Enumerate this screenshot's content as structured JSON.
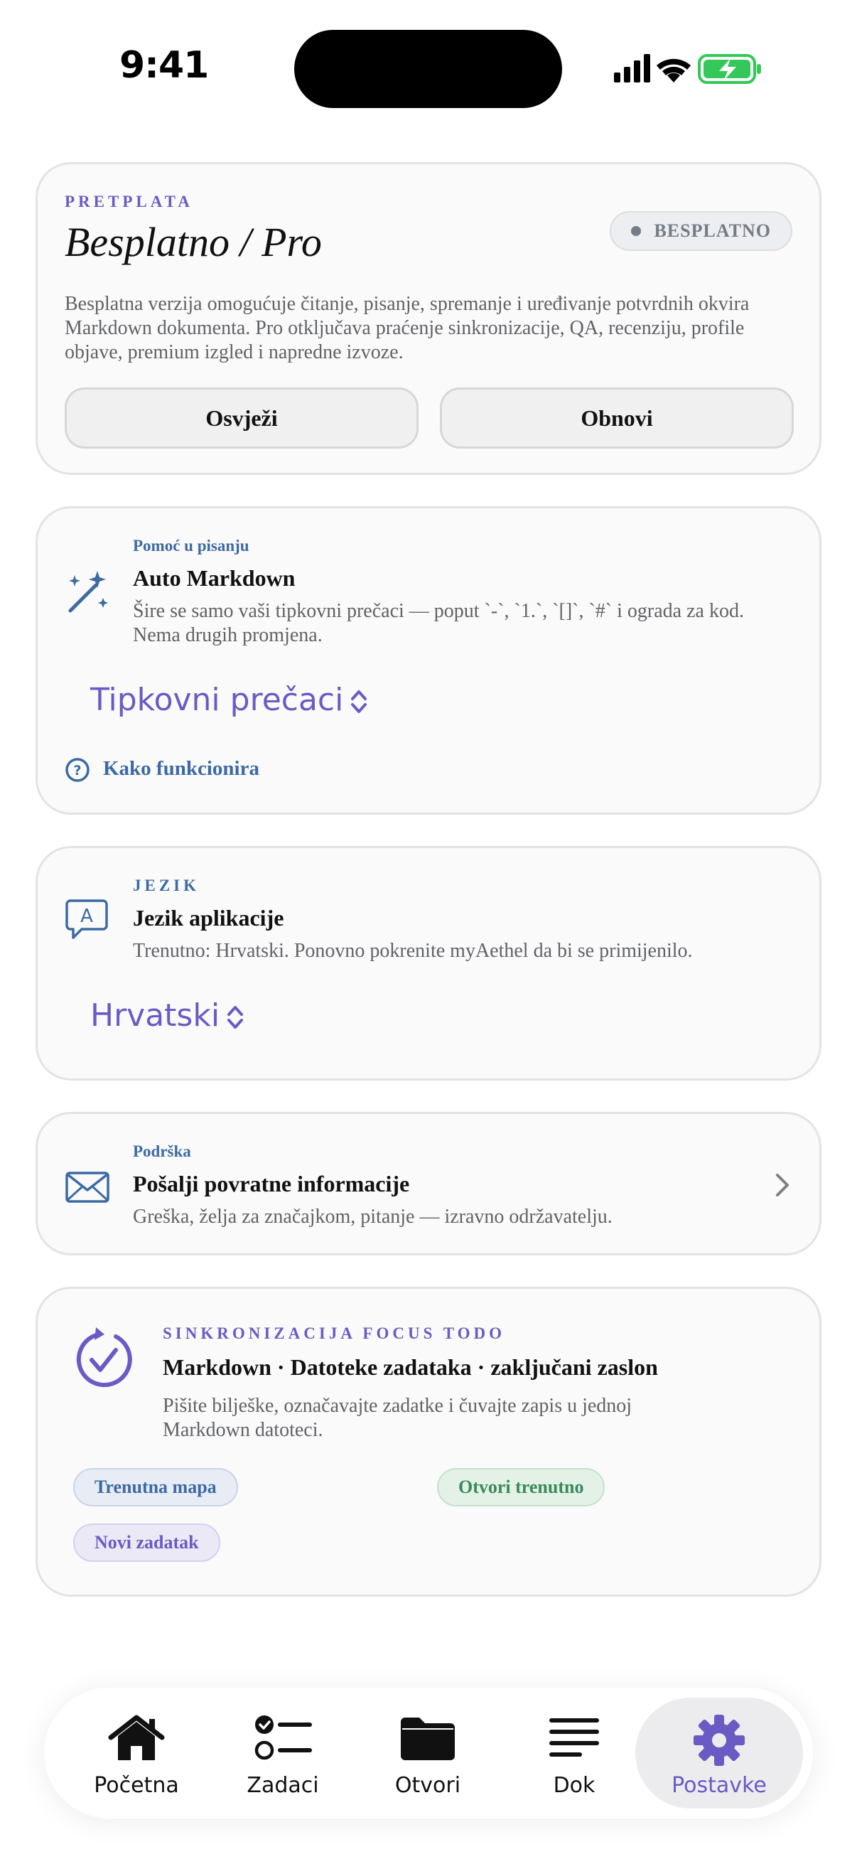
{
  "status_bar": {
    "time": "9:41",
    "icons": [
      "cellular-icon",
      "wifi-icon",
      "battery-charging-icon"
    ]
  },
  "colors": {
    "accent_purple": "#6a5bc4",
    "accent_blue": "#3d6aa3",
    "accent_green": "#3a8a5a",
    "battery_green": "#34c759"
  },
  "subscription": {
    "eyebrow": "PRETPLATA",
    "title": "Besplatno / Pro",
    "badge": "BESPLATNO",
    "description": "Besplatna verzija omogućuje čitanje, pisanje, spremanje i uređivanje potvrdnih okvira Markdown dokumenta. Pro otključava praćenje sinkronizacije, QA, recenziju, profile objave, premium izgled i napredne izvoze.",
    "refresh_label": "Osvježi",
    "restore_label": "Obnovi"
  },
  "writing_help": {
    "eyebrow": "Pomoć u pisanju",
    "title": "Auto Markdown",
    "description": "Šire se samo vaši tipkovni prečaci — poput `-`, `1.`, `[]`, `#` i ograda za kod. Nema drugih promjena.",
    "picker_value": "Tipkovni prečaci",
    "help_link": "Kako funkcionira"
  },
  "language": {
    "eyebrow": "JEZIK",
    "title": "Jezik aplikacije",
    "description": "Trenutno: Hrvatski. Ponovno pokrenite myAethel da bi se primijenilo.",
    "picker_value": "Hrvatski"
  },
  "support": {
    "eyebrow": "Podrška",
    "title": "Pošalji povratne informacije",
    "description": "Greška, želja za značajkom, pitanje — izravno održavatelju."
  },
  "sync": {
    "eyebrow": "SINKRONIZACIJA FOCUS TODO",
    "title": "Markdown · Datoteke zadataka · zaključani zaslon",
    "description": "Pišite bilješke, označavajte zadatke i čuvajte zapis u jednoj Markdown datoteci.",
    "chips": [
      "Trenutna mapa",
      "Otvori trenutno",
      "Novi zadatak"
    ]
  },
  "tabbar": {
    "tabs": [
      {
        "label": "Početna",
        "icon": "house-icon"
      },
      {
        "label": "Zadaci",
        "icon": "checklist-icon"
      },
      {
        "label": "Otvori",
        "icon": "folder-icon"
      },
      {
        "label": "Dok",
        "icon": "text-lines-icon"
      },
      {
        "label": "Postavke",
        "icon": "gear-icon"
      }
    ],
    "active": "Postavke"
  }
}
